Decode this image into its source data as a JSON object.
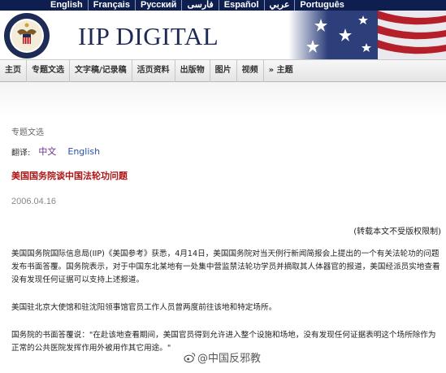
{
  "languages": [
    "English",
    "Français",
    "Русский",
    "فارسی",
    "Español",
    "عربي",
    "Português"
  ],
  "brand": {
    "name": "IIP DIGITAL",
    "seal_text": "UNITED STATES OF AMERICA · EMBASSY"
  },
  "nav": {
    "items": [
      "主页",
      "专题文选",
      "文字稿/记录稿",
      "活页资料",
      "出版物",
      "图片",
      "视频",
      "» 主题"
    ]
  },
  "article": {
    "section": "专题文选",
    "translate_label": "翻译:",
    "translate_zh": "中文",
    "translate_en": "English",
    "title": "美国国务院谈中国法轮功问题",
    "date": "2006.04.16",
    "copyright_note": "(转载本文不受版权限制)",
    "paragraphs": [
      "美国国务院国际信息局(IIP)《美国参考》获悉，4月14日，美国国务院对当天例行新闻简报会上提出的一个有关法轮功的问题发布书面答覆。国务院表示，对于中国东北某地有一处集中营监禁法轮功学员并摘取其人体器官的报道，美国经派员实地查看没有发现任何证据可以支持上述报道。",
      "美国驻北京大使馆和驻沈阳领事馆官员工作人员曾两度前往该地和特定场所。",
      "国务院的书面答覆说：\"在赴该地查看期间，美国官员得到允许进入整个设施和场地，没有发现任何证据表明这个场所除作为正常的公共医院发挥作用外被用作其它用途。\""
    ]
  },
  "watermark": "@中国反邪教",
  "colors": {
    "lang_bar": "#0e1f4f",
    "title_red": "#b01414",
    "brand_navy": "#1d2b55"
  }
}
